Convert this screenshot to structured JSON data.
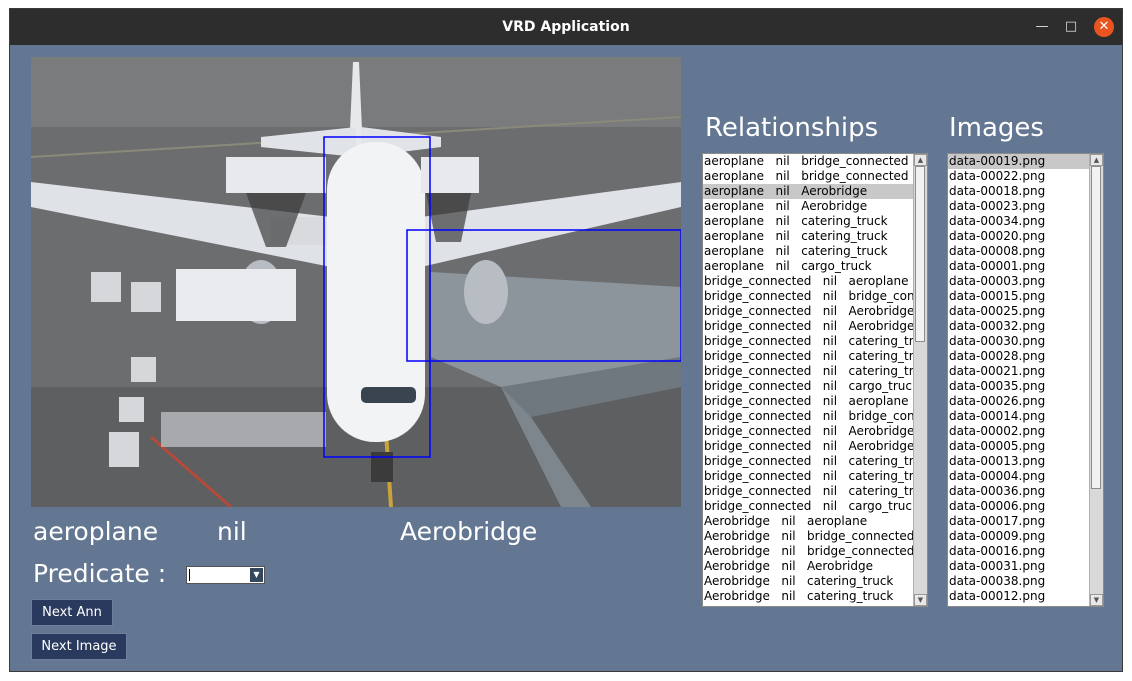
{
  "window": {
    "title": "VRD Application",
    "minimize_icon": "minimize-icon",
    "maximize_icon": "maximize-icon",
    "close_icon": "close-icon"
  },
  "image_view": {
    "image": "airport apron photo: aeroplane at gate with jet bridge and catering trucks",
    "box_color": "#0000ff"
  },
  "annotation": {
    "subject": "aeroplane",
    "predicate": "nil",
    "object": "Aerobridge",
    "predicate_label": "Predicate :",
    "predicate_value": ""
  },
  "buttons": {
    "next_ann": "Next Ann",
    "next_image": "Next Image"
  },
  "relationships": {
    "heading": "Relationships",
    "selected_index": 2,
    "items": [
      "aeroplane   nil   bridge_connected",
      "aeroplane   nil   bridge_connected",
      "aeroplane   nil   Aerobridge",
      "aeroplane   nil   Aerobridge",
      "aeroplane   nil   catering_truck",
      "aeroplane   nil   catering_truck",
      "aeroplane   nil   catering_truck",
      "aeroplane   nil   cargo_truck",
      "bridge_connected   nil   aeroplane",
      "bridge_connected   nil   bridge_conn",
      "bridge_connected   nil   Aerobridge",
      "bridge_connected   nil   Aerobridge",
      "bridge_connected   nil   catering_truc",
      "bridge_connected   nil   catering_truc",
      "bridge_connected   nil   catering_truc",
      "bridge_connected   nil   cargo_truck",
      "bridge_connected   nil   aeroplane",
      "bridge_connected   nil   bridge_conn",
      "bridge_connected   nil   Aerobridge",
      "bridge_connected   nil   Aerobridge",
      "bridge_connected   nil   catering_truc",
      "bridge_connected   nil   catering_truc",
      "bridge_connected   nil   catering_truc",
      "bridge_connected   nil   cargo_truck",
      "Aerobridge   nil   aeroplane",
      "Aerobridge   nil   bridge_connected",
      "Aerobridge   nil   bridge_connected",
      "Aerobridge   nil   Aerobridge",
      "Aerobridge   nil   catering_truck",
      "Aerobridge   nil   catering_truck"
    ]
  },
  "images": {
    "heading": "Images",
    "selected_index": 0,
    "items": [
      "data-00019.png",
      "data-00022.png",
      "data-00018.png",
      "data-00023.png",
      "data-00034.png",
      "data-00020.png",
      "data-00008.png",
      "data-00001.png",
      "data-00003.png",
      "data-00015.png",
      "data-00025.png",
      "data-00032.png",
      "data-00030.png",
      "data-00028.png",
      "data-00021.png",
      "data-00035.png",
      "data-00026.png",
      "data-00014.png",
      "data-00002.png",
      "data-00005.png",
      "data-00013.png",
      "data-00004.png",
      "data-00036.png",
      "data-00006.png",
      "data-00017.png",
      "data-00009.png",
      "data-00016.png",
      "data-00031.png",
      "data-00038.png",
      "data-00012.png"
    ]
  }
}
